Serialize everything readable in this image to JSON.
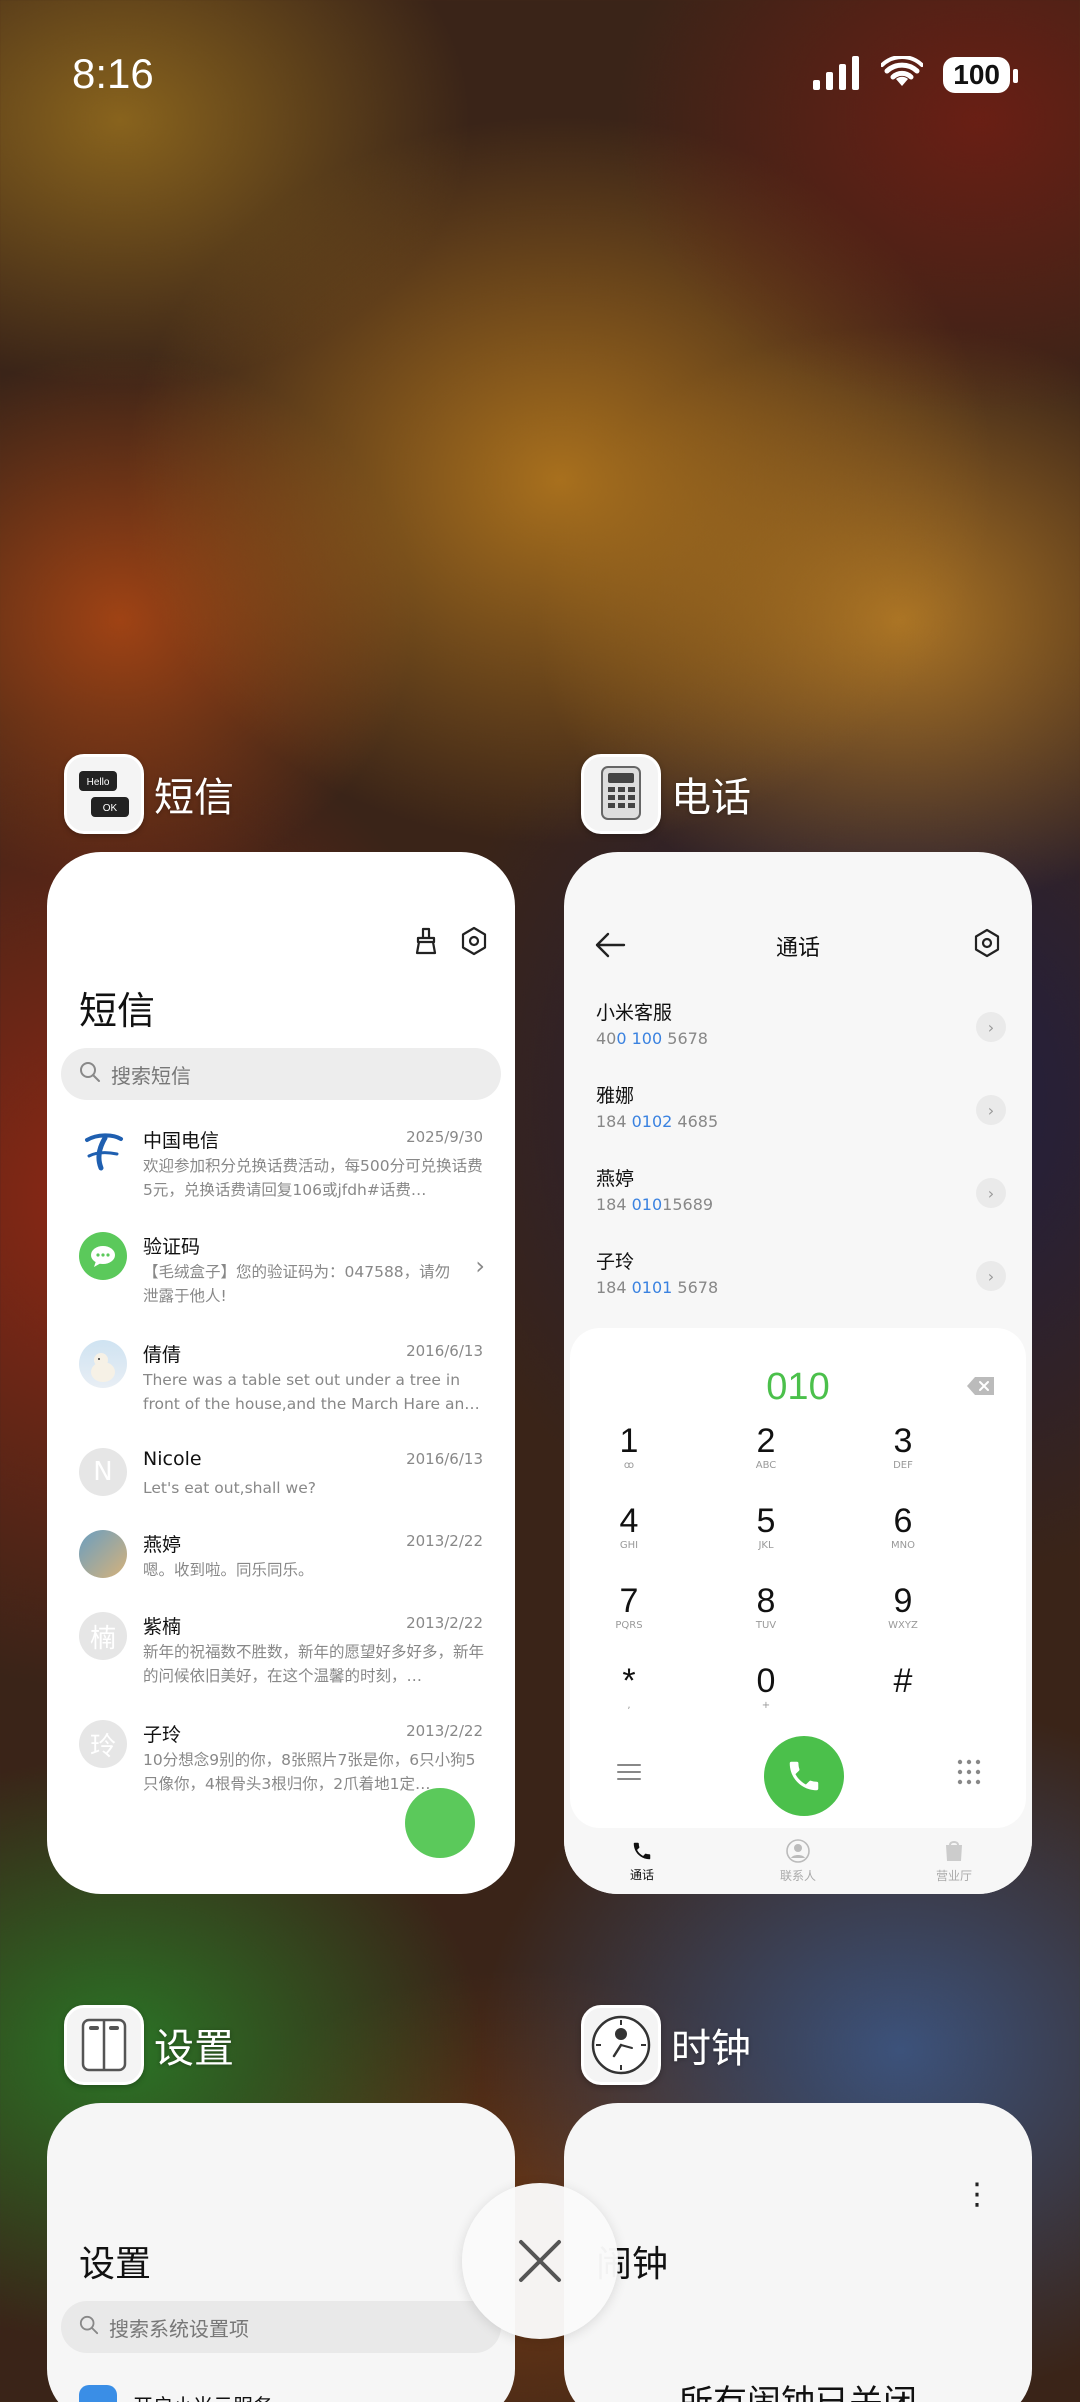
{
  "status_bar": {
    "time": "8:16",
    "battery": "100"
  },
  "apps": {
    "sms": {
      "label": "短信",
      "title": "短信",
      "search_placeholder": "搜索短信",
      "messages": [
        {
          "name": "中国电信",
          "date": "2025/9/30",
          "preview": "欢迎参加积分兑换话费活动，每500分可兑换话费5元，兑换话费请回复106或jfdh#话费…"
        },
        {
          "name": "验证码",
          "date": "",
          "preview": "【毛绒盒子】您的验证码为：047588，请勿泄露于他人!"
        },
        {
          "name": "倩倩",
          "date": "2016/6/13",
          "preview": "There was a table set out under a tree in front of the house,and the March Hare an…"
        },
        {
          "name": "Nicole",
          "date": "2016/6/13",
          "preview": "Let's eat out,shall we?",
          "avatar_letter": "N"
        },
        {
          "name": "燕婷",
          "date": "2013/2/22",
          "preview": "嗯。收到啦。同乐同乐。"
        },
        {
          "name": "紫楠",
          "date": "2013/2/22",
          "preview": "新年的祝福数不胜数，新年的愿望好多好多，新年的问候依旧美好，在这个温馨的时刻，…",
          "avatar_letter": "楠"
        },
        {
          "name": "子玲",
          "date": "2013/2/22",
          "preview": "10分想念9别的你，8张照片7张是你，6只小狗5只像你，4根骨头3根归你，2爪着地1定…",
          "avatar_letter": "玲"
        }
      ]
    },
    "phone": {
      "label": "电话",
      "title": "通话",
      "calls": [
        {
          "name": "小米客服",
          "num_pre": "40",
          "num_hl": "0 100",
          "num_post": " 5678"
        },
        {
          "name": "雅娜",
          "num_pre": "184 ",
          "num_hl": "0102",
          "num_post": " 4685"
        },
        {
          "name": "燕婷",
          "num_pre": "184 ",
          "num_hl": "010",
          "num_post": "15689"
        },
        {
          "name": "子玲",
          "num_pre": "184 ",
          "num_hl": "0101",
          "num_post": " 5678"
        }
      ],
      "dial_input": "010",
      "keys": [
        {
          "digit": "1",
          "sub": "ꝏ"
        },
        {
          "digit": "2",
          "sub": "ABC"
        },
        {
          "digit": "3",
          "sub": "DEF"
        },
        {
          "digit": "4",
          "sub": "GHI"
        },
        {
          "digit": "5",
          "sub": "JKL"
        },
        {
          "digit": "6",
          "sub": "MNO"
        },
        {
          "digit": "7",
          "sub": "PQRS"
        },
        {
          "digit": "8",
          "sub": "TUV"
        },
        {
          "digit": "9",
          "sub": "WXYZ"
        },
        {
          "digit": "*",
          "sub": ","
        },
        {
          "digit": "0",
          "sub": "+"
        },
        {
          "digit": "#",
          "sub": ""
        }
      ],
      "nav": [
        "通话",
        "联系人",
        "营业厅"
      ]
    },
    "settings": {
      "label": "设置",
      "title": "设置",
      "search_placeholder": "搜索系统设置项",
      "first_item": "开启小米云服务"
    },
    "clock": {
      "label": "时钟",
      "title": "闹钟",
      "status": "所有闹钟已关闭"
    }
  },
  "colors": {
    "accent_green": "#4bc04b",
    "highlight_blue": "#3a82e0"
  }
}
